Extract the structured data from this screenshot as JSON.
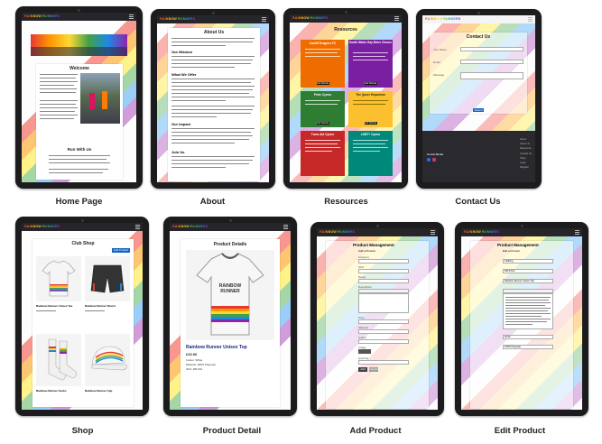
{
  "captions": [
    "Home Page",
    "About",
    "Resources",
    "Contact Us",
    "Shop",
    "Product Detail",
    "Add Product",
    "Edit Product"
  ],
  "brand": {
    "logo_text": "RAINBOW RUNNERS"
  },
  "home": {
    "welcome_heading": "Welcome",
    "run_heading": "Run With Us"
  },
  "about": {
    "title": "About Us",
    "sections": [
      "Our Mission",
      "What We Offer",
      "Our Impact",
      "Join Us"
    ]
  },
  "resources": {
    "title": "Resources",
    "cards": [
      {
        "name": "Cardiff Dragons FC",
        "color": "#ef6c00",
        "button": "Visit Website"
      },
      {
        "name": "South Wales Gay Mens Chorus",
        "color": "#7b1fa2",
        "button": "Visit Website"
      },
      {
        "name": "Pride Cymru",
        "color": "#2e7d32",
        "button": "Visit Website"
      },
      {
        "name": "The Queer Emporium",
        "color": "#fbc02d",
        "button": "Visit Website"
      },
      {
        "name": "Trans Aid Cymru",
        "color": "#c62828",
        "button": "Visit Website"
      },
      {
        "name": "LGBT+ Cymru",
        "color": "#00897b",
        "button": "Visit Website"
      }
    ]
  },
  "contact": {
    "title": "Contact Us",
    "fields": [
      "Your Name",
      "Email",
      "Message"
    ],
    "submit": "Submit",
    "social": "Social Media",
    "footer_links": [
      "Home",
      "About Us",
      "Resources",
      "Contact Us",
      "Shop",
      "Login",
      "Register"
    ]
  },
  "shop": {
    "title": "Club Shop",
    "add_button": "Add Product",
    "items": [
      "Rainbow Runner Unisex Tee",
      "Rainbow Runner Shorts",
      "Rainbow Runner Socks",
      "Rainbow Runner Cap"
    ]
  },
  "product": {
    "title": "Product Details",
    "name": "Rainbow Runner Unisex Top",
    "price": "£20.00",
    "shirt_text": "RAINBOW RUNNER",
    "rows": [
      "Colour: White",
      "Material: 100% Polyester",
      "SKU: RR-001"
    ]
  },
  "add_product": {
    "title": "Product Management",
    "subtitle": "Add a Product",
    "fields": [
      "Category",
      "SKU",
      "Name",
      "Description",
      "Price",
      "Material",
      "Colour",
      "Image",
      "Quantity"
    ],
    "submit": "Add Product",
    "cancel": "Cancel"
  },
  "edit_product": {
    "title": "Product Management",
    "subtitle": "Edit a Product",
    "sku": "RR-ST-01",
    "name": "Rainbow Runner Unisex Top",
    "category": "Clothing",
    "price": "20.00",
    "material": "100% Polyester"
  }
}
